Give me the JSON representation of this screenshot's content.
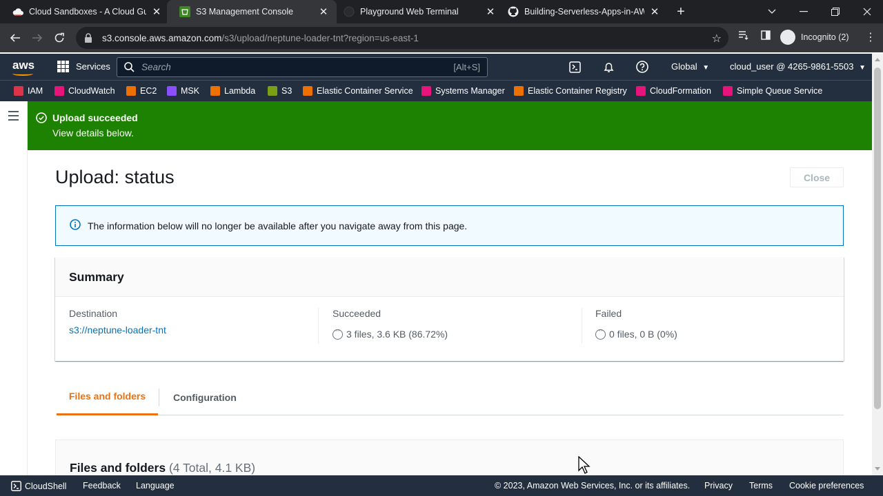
{
  "browser": {
    "tabs": [
      {
        "title": "Cloud Sandboxes - A Cloud Guru",
        "icon": "acg-cloud-icon"
      },
      {
        "title": "S3 Management Console",
        "icon": "s3-icon"
      },
      {
        "title": "Playground Web Terminal",
        "icon": "terminal-icon"
      },
      {
        "title": "Building-Serverless-Apps-in-AWS",
        "icon": "github-icon"
      }
    ],
    "url_host": "s3.console.aws.amazon.com",
    "url_path": "/s3/upload/neptune-loader-tnt?region=us-east-1",
    "profile_label": "Incognito (2)"
  },
  "aws_header": {
    "logo": "aws",
    "services_label": "Services",
    "search_placeholder": "Search",
    "search_shortcut": "[Alt+S]",
    "region": "Global",
    "account": "cloud_user @ 4265-9861-5503"
  },
  "favorites": [
    {
      "label": "IAM",
      "color": "#dd344c"
    },
    {
      "label": "CloudWatch",
      "color": "#e7157b"
    },
    {
      "label": "EC2",
      "color": "#ed7100"
    },
    {
      "label": "MSK",
      "color": "#8c4fff"
    },
    {
      "label": "Lambda",
      "color": "#ed7100"
    },
    {
      "label": "S3",
      "color": "#7aa116"
    },
    {
      "label": "Elastic Container Service",
      "color": "#ed7100"
    },
    {
      "label": "Systems Manager",
      "color": "#e7157b"
    },
    {
      "label": "Elastic Container Registry",
      "color": "#ed7100"
    },
    {
      "label": "CloudFormation",
      "color": "#e7157b"
    },
    {
      "label": "Simple Queue Service",
      "color": "#e7157b"
    }
  ],
  "flash": {
    "title": "Upload succeeded",
    "subtitle": "View details below.",
    "color": "#1d8102"
  },
  "page": {
    "title": "Upload: status",
    "close_label": "Close",
    "info_text": "The information below will no longer be available after you navigate away from this page."
  },
  "summary": {
    "title": "Summary",
    "destination_label": "Destination",
    "destination_value": "s3://neptune-loader-tnt",
    "succeeded_label": "Succeeded",
    "succeeded_value": "3 files, 3.6 KB (86.72%)",
    "failed_label": "Failed",
    "failed_value": "0 files, 0 B (0%)"
  },
  "content_tabs": [
    {
      "label": "Files and folders",
      "active": true
    },
    {
      "label": "Configuration",
      "active": false
    }
  ],
  "files_section": {
    "title": "Files and folders",
    "count": "(4 Total, 4.1 KB)"
  },
  "footer": {
    "cloudshell": "CloudShell",
    "feedback": "Feedback",
    "language": "Language",
    "copyright": "© 2023, Amazon Web Services, Inc. or its affiliates.",
    "privacy": "Privacy",
    "terms": "Terms",
    "cookies": "Cookie preferences"
  },
  "accent_colors": {
    "aws_orange": "#ff9900",
    "link_blue": "#0073bb",
    "active_tab": "#ec7211"
  }
}
